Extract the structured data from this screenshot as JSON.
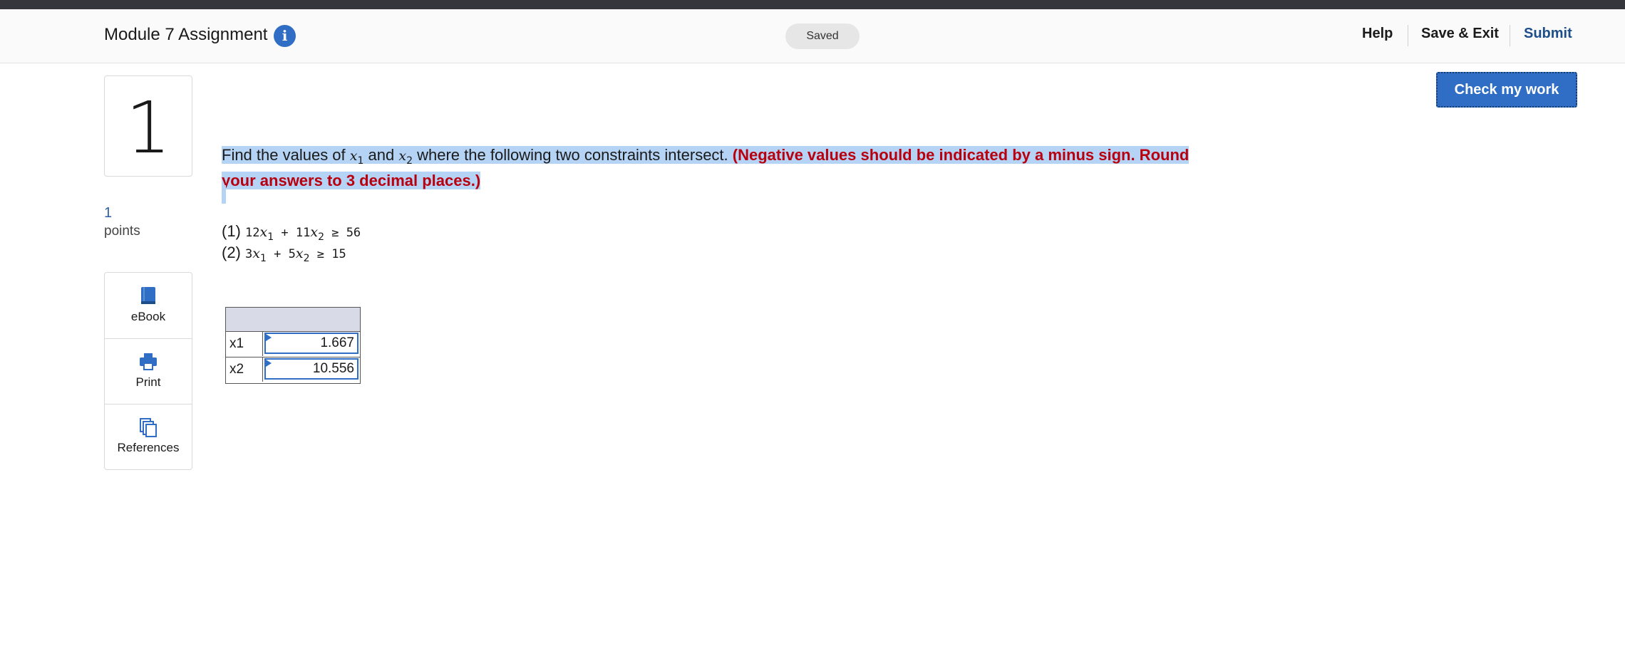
{
  "header": {
    "title": "Module 7 Assignment",
    "info_icon": "info-icon",
    "status": "Saved",
    "nav": {
      "help": "Help",
      "save_exit": "Save & Exit",
      "submit": "Submit"
    }
  },
  "question": {
    "number": "1",
    "points_value": "1",
    "points_label": "points",
    "text_before": "Find the values of ",
    "var1": "x",
    "var1_sub": "1",
    "text_and": " and ",
    "var2": "x",
    "var2_sub": "2",
    "text_after": " where the following two constraints intersect. ",
    "instruction": "(Negative values should be indicated by a minus sign. Round your answers to 3 decimal places.)",
    "constraints": [
      {
        "label": "(1)",
        "coef1": "12",
        "var1": "x",
        "sub1": "1",
        "op": " + ",
        "coef2": "11",
        "var2": "x",
        "sub2": "2",
        "rel": " ≥ 56"
      },
      {
        "label": "(2)",
        "coef1": "3",
        "var1": "x",
        "sub1": "1",
        "op": " + ",
        "coef2": "5",
        "var2": "x",
        "sub2": "2",
        "rel": " ≥ 15"
      }
    ]
  },
  "tools": [
    {
      "label": "eBook",
      "icon": "book-icon"
    },
    {
      "label": "Print",
      "icon": "printer-icon"
    },
    {
      "label": "References",
      "icon": "documents-icon"
    }
  ],
  "check_button": "Check my work",
  "answer_table": {
    "rows": [
      {
        "label": "x1",
        "value": "1.667"
      },
      {
        "label": "x2",
        "value": "10.556"
      }
    ]
  },
  "colors": {
    "accent": "#2f6ec4",
    "instruction_red": "#b8000f",
    "highlight": "#b5d4f5",
    "header_cell": "#d8dbe7"
  }
}
